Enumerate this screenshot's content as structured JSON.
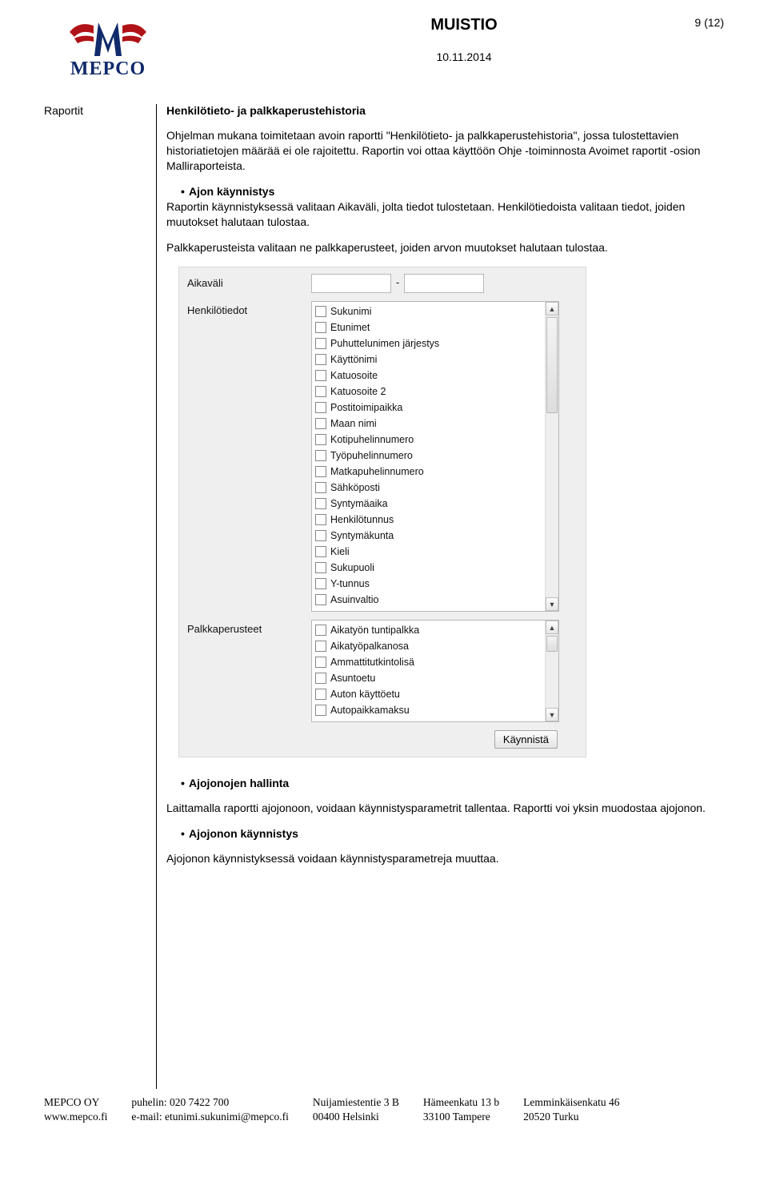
{
  "header": {
    "title": "MUISTIO",
    "page_indicator": "9 (12)",
    "date": "10.11.2014",
    "logo_text": "MEPCO"
  },
  "left_label": "Raportit",
  "section": {
    "heading": "Henkilötieto- ja palkkaperustehistoria",
    "intro_para": "Ohjelman mukana toimitetaan avoin raportti \"Henkilötieto- ja palkkaperustehistoria\", jossa tulostettavien historiatietojen määrää ei ole rajoitettu. Raportin voi ottaa käyttöön Ohje -toiminnosta Avoimet raportit -osion Malliraporteista.",
    "bullet1_title": "Ajon käynnistys",
    "bullet1_para1": "Raportin käynnistyksessä valitaan Aikaväli, jolta tiedot tulostetaan. Henkilötiedoista valitaan tiedot, joiden muutokset halutaan tulostaa.",
    "bullet1_para2": "Palkkaperusteista valitaan ne palkkaperusteet, joiden arvon muutokset halutaan tulostaa.",
    "bullet2_title": "Ajojonojen hallinta",
    "bullet2_para": "Laittamalla raportti ajojonoon, voidaan käynnistysparametrit tallentaa. Raportti voi yksin muodostaa ajojonon.",
    "bullet3_title": "Ajojonon käynnistys",
    "bullet3_para": "Ajojonon käynnistyksessä voidaan käynnistysparametreja muuttaa."
  },
  "form": {
    "label_aikavali": "Aikaväli",
    "date_sep": "-",
    "label_henkilotiedot": "Henkilötiedot",
    "label_palkkaperusteet": "Palkkaperusteet",
    "henkilotiedot_items": [
      "Sukunimi",
      "Etunimet",
      "Puhuttelunimen järjestys",
      "Käyttönimi",
      "Katuosoite",
      "Katuosoite 2",
      "Postitoimipaikka",
      "Maan nimi",
      "Kotipuhelinnumero",
      "Työpuhelinnumero",
      "Matkapuhelinnumero",
      "Sähköposti",
      "Syntymäaika",
      "Henkilötunnus",
      "Syntymäkunta",
      "Kieli",
      "Sukupuoli",
      "Y-tunnus",
      "Asuinvaltio"
    ],
    "palkkaperusteet_items": [
      "Aikatyön tuntipalkka",
      "Aikatyöpalkanosa",
      "Ammattitutkintolisä",
      "Asuntoetu",
      "Auton käyttöetu",
      "Autopaikkamaksu"
    ],
    "btn_launch": "Käynnistä"
  },
  "footer": {
    "c1a": "MEPCO OY",
    "c1b": "www.mepco.fi",
    "c2a": "puhelin: 020 7422 700",
    "c2b": "e-mail: etunimi.sukunimi@mepco.fi",
    "c3a": "Nuijamiestentie 3 B",
    "c3b": "00400 Helsinki",
    "c4a": "Hämeenkatu 13 b",
    "c4b": "33100 Tampere",
    "c5a": "Lemminkäisenkatu 46",
    "c5b": "20520 Turku"
  }
}
